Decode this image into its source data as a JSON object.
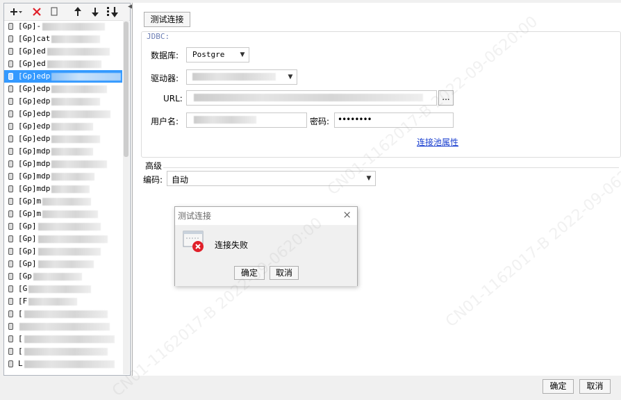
{
  "toolbar": {
    "icons": [
      "plus-icon",
      "delete-icon",
      "copy-icon",
      "up-arrow-icon",
      "down-arrow-icon",
      "sort-icon"
    ]
  },
  "connections": {
    "items": [
      {
        "label": "[Gp]-",
        "blur_w": 90
      },
      {
        "label": "[Gp]cat",
        "blur_w": 70
      },
      {
        "label": "[Gp]ed",
        "blur_w": 90
      },
      {
        "label": "[Gp]ed",
        "blur_w": 78
      },
      {
        "label": "[Gp]edp",
        "blur_w": 100,
        "selected": true
      },
      {
        "label": "[Gp]edp",
        "blur_w": 80
      },
      {
        "label": "[Gp]edp",
        "blur_w": 70
      },
      {
        "label": "[Gp]edp",
        "blur_w": 85
      },
      {
        "label": "[Gp]edp",
        "blur_w": 60
      },
      {
        "label": "[Gp]edp",
        "blur_w": 70
      },
      {
        "label": "[Gp]mdp",
        "blur_w": 60
      },
      {
        "label": "[Gp]mdp",
        "blur_w": 80
      },
      {
        "label": "[Gp]mdp",
        "blur_w": 62
      },
      {
        "label": "[Gp]mdp",
        "blur_w": 55
      },
      {
        "label": "[Gp]m",
        "blur_w": 70
      },
      {
        "label": "[Gp]m",
        "blur_w": 80
      },
      {
        "label": "[Gp]",
        "blur_w": 90
      },
      {
        "label": "[Gp]",
        "blur_w": 100
      },
      {
        "label": "[Gp]",
        "blur_w": 90
      },
      {
        "label": "[Gp]",
        "blur_w": 80
      },
      {
        "label": "[Gp",
        "blur_w": 70
      },
      {
        "label": "[G",
        "blur_w": 90
      },
      {
        "label": "[F",
        "blur_w": 70
      },
      {
        "label": "[",
        "blur_w": 120
      },
      {
        "label": "",
        "blur_w": 130
      },
      {
        "label": "[",
        "blur_w": 130
      },
      {
        "label": "[",
        "blur_w": 120
      },
      {
        "label": "L",
        "blur_w": 130
      }
    ]
  },
  "main": {
    "test_button": "测试连接",
    "jdbc_legend": "JDBC:",
    "db_label": "数据库:",
    "db_value": "Postgre",
    "driver_label": "驱动器:",
    "url_label": "URL:",
    "url_browse": "...",
    "user_label": "用户名:",
    "password_label": "密码:",
    "password_value": "••••••••",
    "pool_link": "连接池属性",
    "advanced_label": "高级",
    "encoding_label": "编码:",
    "encoding_value": "自动"
  },
  "dialog": {
    "title": "测试连接",
    "close": "×",
    "message": "连接失败",
    "ok": "确定",
    "cancel": "取消"
  },
  "footer": {
    "ok": "确定",
    "cancel": "取消"
  },
  "watermark": "CN01-1162017-B 2022-09-0620:00",
  "colors": {
    "selection": "#3399ff",
    "error": "#e0202a",
    "link": "#1a3fcf"
  }
}
